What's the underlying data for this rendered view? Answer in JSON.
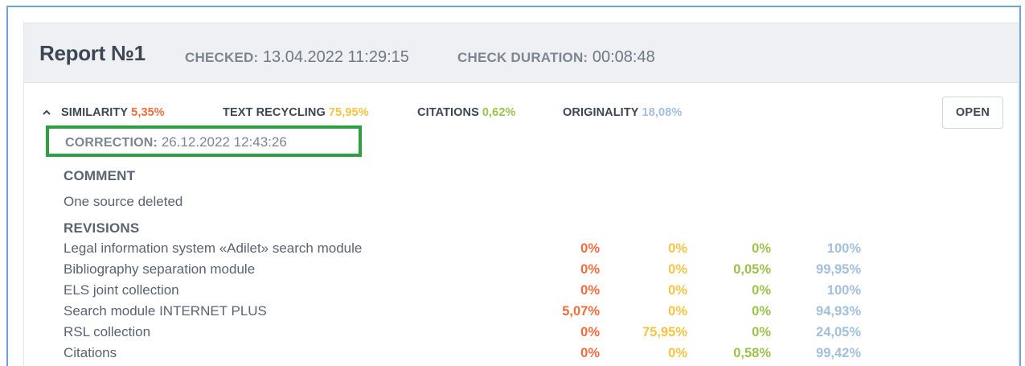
{
  "header": {
    "title": "Report №1",
    "checked_label": "CHECKED:",
    "checked_value": "13.04.2022 11:29:15",
    "duration_label": "CHECK DURATION:",
    "duration_value": "00:08:48"
  },
  "stats": {
    "similarity_label": "SIMILARITY",
    "similarity_value": "5,35%",
    "recycling_label": "TEXT RECYCLING",
    "recycling_value": "75,95%",
    "citations_label": "CITATIONS",
    "citations_value": "0,62%",
    "originality_label": "ORIGINALITY",
    "originality_value": "18,08%"
  },
  "open_button": "OPEN",
  "correction": {
    "label": "CORRECTION:",
    "value": "26.12.2022 12:43:26"
  },
  "comment": {
    "label": "COMMENT",
    "text": "One source deleted"
  },
  "revisions": {
    "label": "REVISIONS",
    "rows": [
      {
        "name": "Legal information system «Adilet» search module",
        "similarity": "0%",
        "recycling": "0%",
        "citations": "0%",
        "originality": "100%"
      },
      {
        "name": "Bibliography separation module",
        "similarity": "0%",
        "recycling": "0%",
        "citations": "0,05%",
        "originality": "99,95%"
      },
      {
        "name": "ELS joint collection",
        "similarity": "0%",
        "recycling": "0%",
        "citations": "0%",
        "originality": "100%"
      },
      {
        "name": "Search module INTERNET PLUS",
        "similarity": "5,07%",
        "recycling": "0%",
        "citations": "0%",
        "originality": "94,93%"
      },
      {
        "name": "RSL collection",
        "similarity": "0%",
        "recycling": "75,95%",
        "citations": "0%",
        "originality": "24,05%"
      },
      {
        "name": "Citations",
        "similarity": "0%",
        "recycling": "0%",
        "citations": "0,58%",
        "originality": "99,42%"
      }
    ]
  },
  "colors": {
    "similarity": "#ef6d3d",
    "recycling": "#f5c443",
    "citations": "#9cc24c",
    "originality": "#a2bfdc",
    "highlight_box": "#2ea043",
    "frame_border": "#6fa3d8"
  },
  "icons": {
    "collapse": "chevron-up-icon"
  }
}
